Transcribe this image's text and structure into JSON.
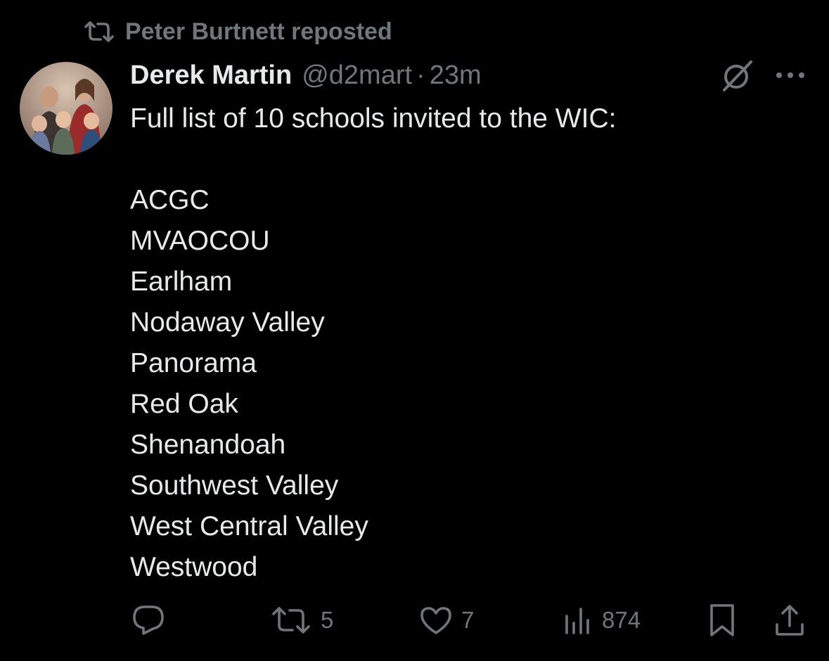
{
  "repost_banner": {
    "icon": "repost-icon",
    "text": "Peter Burtnett reposted"
  },
  "tweet": {
    "author": {
      "name": "Derek Martin",
      "handle": "@d2mart",
      "avatar": "family-photo-avatar"
    },
    "separator": "·",
    "time": "23m",
    "header_icons": [
      "grok-icon",
      "more-icon"
    ],
    "intro": "Full list of 10 schools invited to the WIC:",
    "schools": [
      "ACGC",
      "MVAOCOU",
      "Earlham",
      "Nodaway Valley",
      "Panorama",
      "Red Oak",
      "Shenandoah",
      "Southwest Valley",
      "West Central Valley",
      "Westwood"
    ]
  },
  "actions": {
    "reply": {
      "icon": "reply-icon",
      "count": ""
    },
    "repost": {
      "icon": "repost-icon",
      "count": "5"
    },
    "like": {
      "icon": "heart-icon",
      "count": "7"
    },
    "views": {
      "icon": "views-icon",
      "count": "874"
    },
    "bookmark": {
      "icon": "bookmark-icon"
    },
    "share": {
      "icon": "share-icon"
    }
  },
  "colors": {
    "background": "#000000",
    "primary_text": "#e7e9ea",
    "secondary_text": "#71767b"
  }
}
